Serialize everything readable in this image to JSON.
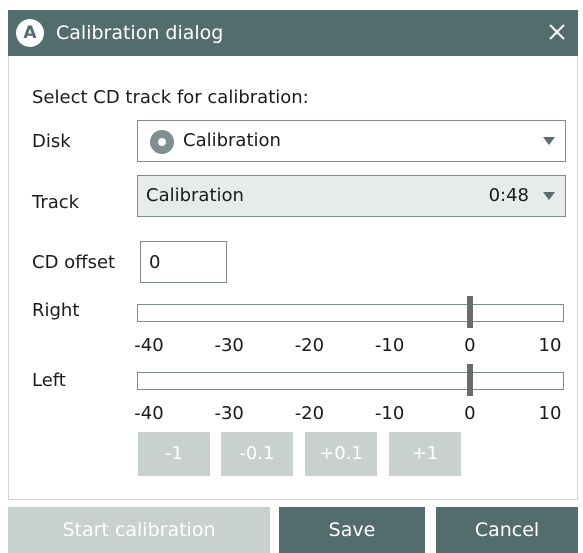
{
  "window": {
    "title": "Calibration dialog",
    "app_icon_letter": "A"
  },
  "form": {
    "instruction": "Select CD track for calibration:",
    "disk_label": "Disk",
    "disk_value": "Calibration",
    "track_label": "Track",
    "track_value": "Calibration",
    "track_duration": "0:48",
    "cd_offset_label": "CD offset",
    "cd_offset_value": "0"
  },
  "meters": {
    "scale_ticks": [
      "-40",
      "-30",
      "-20",
      "-10",
      "0",
      "10"
    ],
    "right": {
      "label": "Right",
      "level_db": 0
    },
    "left": {
      "label": "Left",
      "level_db": 0
    }
  },
  "steps": [
    "-1",
    "-0.1",
    "+0.1",
    "+1"
  ],
  "footer": {
    "start_label": "Start calibration",
    "save_label": "Save",
    "cancel_label": "Cancel"
  },
  "colors": {
    "titlebar": "#536d6f",
    "primary_button": "#536d6f",
    "disabled_button": "#c8d0d0",
    "border": "#7d8c8c"
  }
}
